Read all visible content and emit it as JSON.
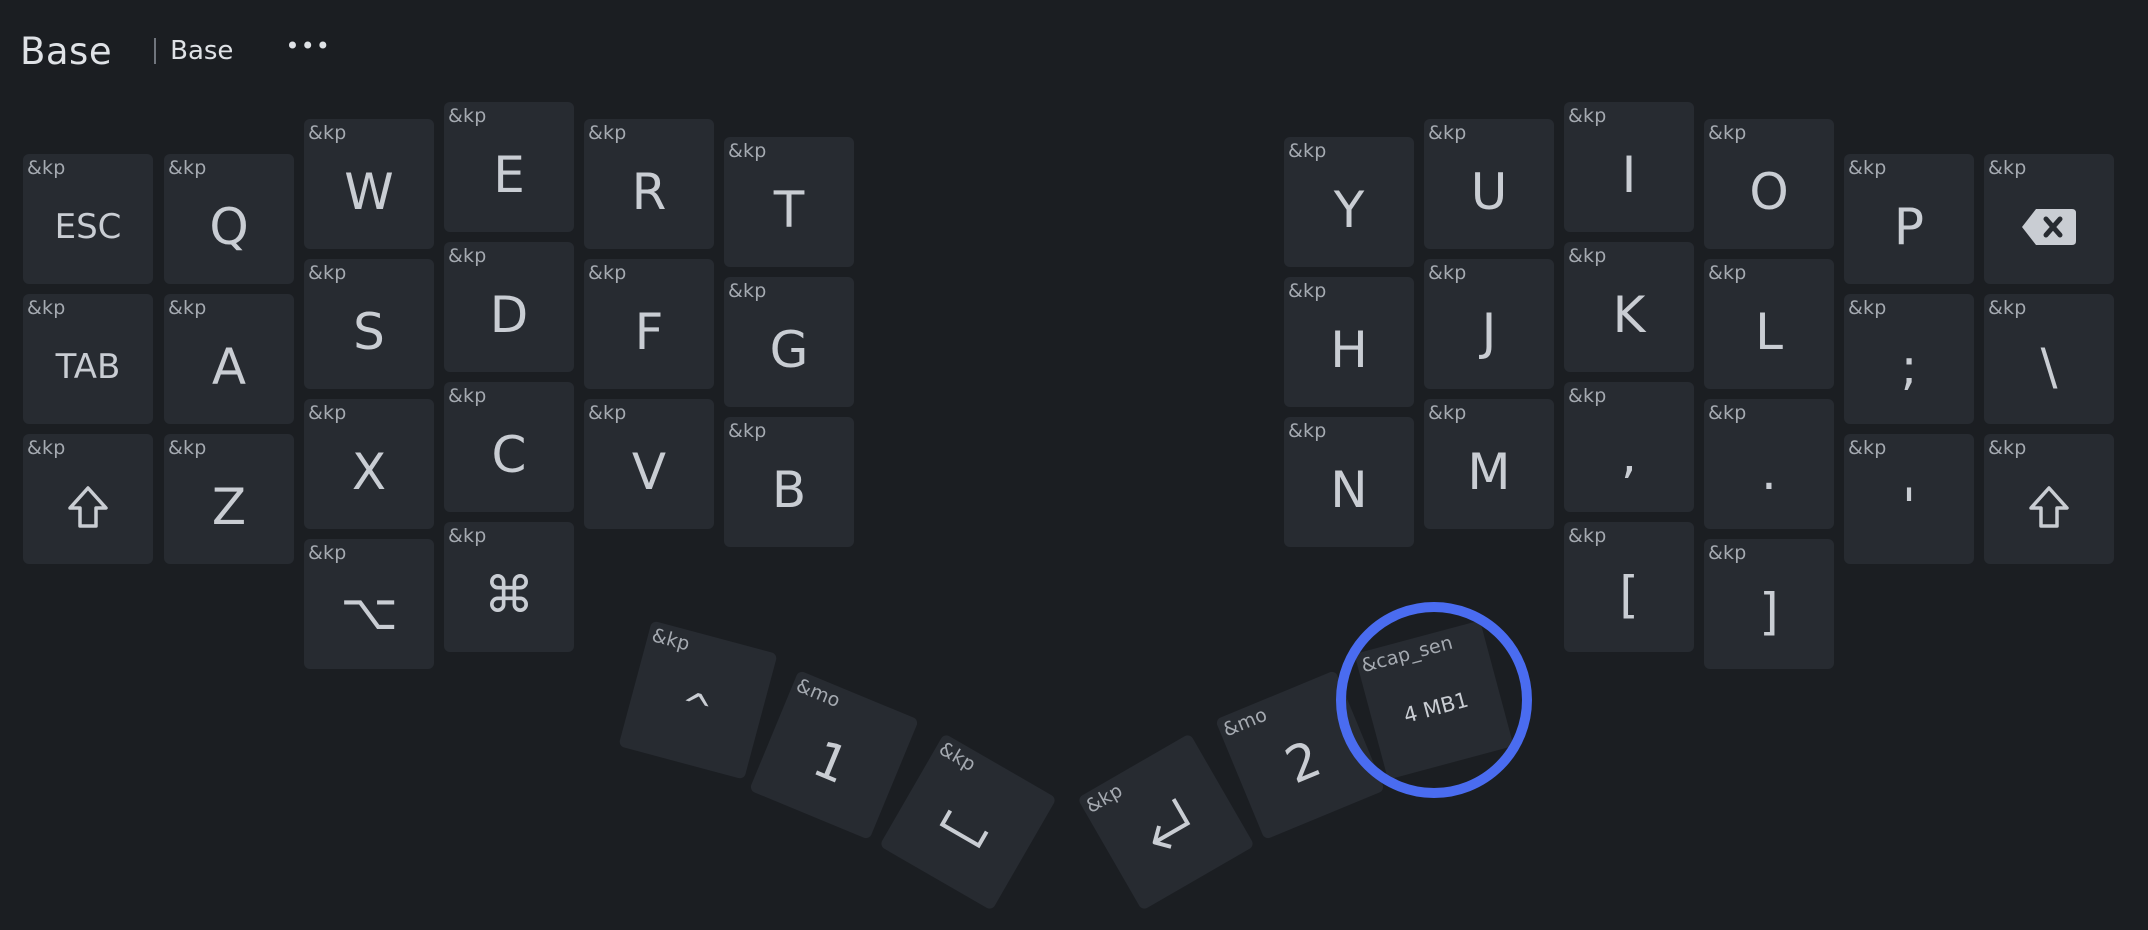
{
  "header": {
    "title": "Base",
    "layer_name": "Base",
    "more_label": "•••"
  },
  "colors": {
    "background": "#1b1e22",
    "key_fill": "#272b31",
    "key_text": "#c9cdd3",
    "binding_text": "#a5aab1",
    "highlight": "#4a6cf0"
  },
  "keys": [
    {
      "id": "k0",
      "binding": "&kp",
      "param": "ESC"
    },
    {
      "id": "k1",
      "binding": "&kp",
      "param": "Q"
    },
    {
      "id": "k2",
      "binding": "&kp",
      "param": "W"
    },
    {
      "id": "k3",
      "binding": "&kp",
      "param": "E"
    },
    {
      "id": "k4",
      "binding": "&kp",
      "param": "R"
    },
    {
      "id": "k5",
      "binding": "&kp",
      "param": "T"
    },
    {
      "id": "k6",
      "binding": "&kp",
      "param": "Y"
    },
    {
      "id": "k7",
      "binding": "&kp",
      "param": "U"
    },
    {
      "id": "k8",
      "binding": "&kp",
      "param": "I"
    },
    {
      "id": "k9",
      "binding": "&kp",
      "param": "O"
    },
    {
      "id": "k10",
      "binding": "&kp",
      "param": "P"
    },
    {
      "id": "k11",
      "binding": "&kp",
      "param": "",
      "icon": "backspace-icon"
    },
    {
      "id": "k12",
      "binding": "&kp",
      "param": "TAB"
    },
    {
      "id": "k13",
      "binding": "&kp",
      "param": "A"
    },
    {
      "id": "k14",
      "binding": "&kp",
      "param": "S"
    },
    {
      "id": "k15",
      "binding": "&kp",
      "param": "D"
    },
    {
      "id": "k16",
      "binding": "&kp",
      "param": "F"
    },
    {
      "id": "k17",
      "binding": "&kp",
      "param": "G"
    },
    {
      "id": "k18",
      "binding": "&kp",
      "param": "H"
    },
    {
      "id": "k19",
      "binding": "&kp",
      "param": "J"
    },
    {
      "id": "k20",
      "binding": "&kp",
      "param": "K"
    },
    {
      "id": "k21",
      "binding": "&kp",
      "param": "L"
    },
    {
      "id": "k22",
      "binding": "&kp",
      "param": ";"
    },
    {
      "id": "k23",
      "binding": "&kp",
      "param": "\\"
    },
    {
      "id": "k24",
      "binding": "&kp",
      "param": "",
      "icon": "shift-icon"
    },
    {
      "id": "k25",
      "binding": "&kp",
      "param": "Z"
    },
    {
      "id": "k26",
      "binding": "&kp",
      "param": "X"
    },
    {
      "id": "k27",
      "binding": "&kp",
      "param": "C"
    },
    {
      "id": "k28",
      "binding": "&kp",
      "param": "V"
    },
    {
      "id": "k29",
      "binding": "&kp",
      "param": "B"
    },
    {
      "id": "k30",
      "binding": "&kp",
      "param": "N"
    },
    {
      "id": "k31",
      "binding": "&kp",
      "param": "M"
    },
    {
      "id": "k32",
      "binding": "&kp",
      "param": ","
    },
    {
      "id": "k33",
      "binding": "&kp",
      "param": "."
    },
    {
      "id": "k34",
      "binding": "&kp",
      "param": "'"
    },
    {
      "id": "k35",
      "binding": "&kp",
      "param": "",
      "icon": "shift-icon"
    },
    {
      "id": "k36",
      "binding": "&kp",
      "param": "⌥"
    },
    {
      "id": "k37",
      "binding": "&kp",
      "param": "⌘"
    },
    {
      "id": "k38",
      "binding": "&kp",
      "param": "["
    },
    {
      "id": "k39",
      "binding": "&kp",
      "param": "]"
    },
    {
      "id": "k40",
      "binding": "&kp",
      "param": "^"
    },
    {
      "id": "k41",
      "binding": "&mo",
      "param": "1"
    },
    {
      "id": "k42",
      "binding": "&kp",
      "param": "",
      "icon": "space-icon"
    },
    {
      "id": "k43",
      "binding": "&kp",
      "param": "",
      "icon": "return-icon"
    },
    {
      "id": "k44",
      "binding": "&mo",
      "param": "2"
    },
    {
      "id": "k45",
      "binding": "&cap_sen",
      "param": "4 MB1",
      "selected": true
    }
  ]
}
